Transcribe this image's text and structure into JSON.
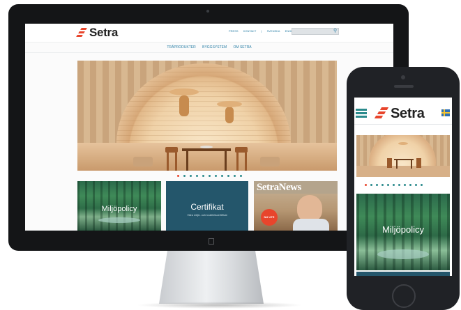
{
  "desktop": {
    "brand": "Setra",
    "top_links": [
      "PRESS",
      "KONTAKT",
      "|",
      "SVENSKA",
      "ENGLISH"
    ],
    "search": {
      "placeholder": "",
      "icon": "search-icon"
    },
    "nav": [
      "TRÄPRODUKTER",
      "BYGGSYSTEM",
      "OM SETRA"
    ],
    "hero": {
      "slides": 11,
      "active_slide": 1
    },
    "tiles": {
      "forest_label": "Miljöpolicy",
      "cert_title": "Certifikat",
      "cert_subtitle": "Våra miljö- och kvalitetscertifikat",
      "news_title": "SetraNews",
      "news_badge": "NU UTE"
    }
  },
  "mobile": {
    "brand": "Setra",
    "menu_icon": "hamburger-icon",
    "flag_icon": "swedish-flag-icon",
    "hero": {
      "slides": 11,
      "active_slide": 1
    },
    "tile_label": "Miljöpolicy"
  },
  "colors": {
    "brand_orange": "#e8452c",
    "link_blue": "#2a7fa6",
    "teal": "#2a8a8c",
    "cert_tile": "#24566b"
  }
}
